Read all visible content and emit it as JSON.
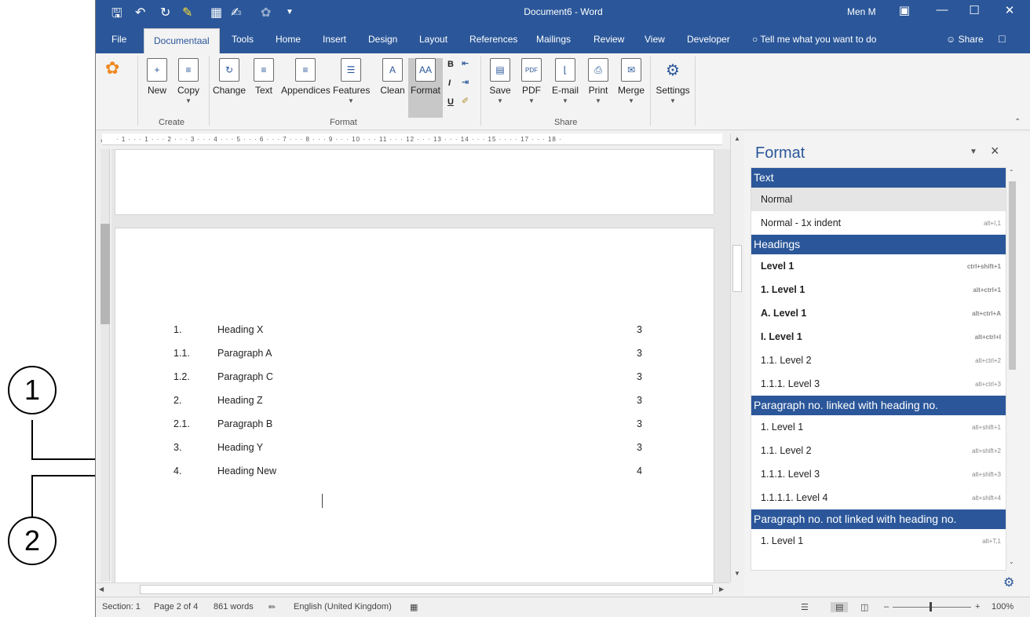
{
  "callouts": [
    "1",
    "2"
  ],
  "titlebar": {
    "title": "Document6 - Word",
    "user": "Men M",
    "icons": [
      "save-icon",
      "undo-icon",
      "redo-icon",
      "highlight-icon",
      "table-icon",
      "spelling-icon",
      "brush-icon",
      "customize-icon"
    ]
  },
  "tabs": [
    "File",
    "Documentaal",
    "Tools",
    "Home",
    "Insert",
    "Design",
    "Layout",
    "References",
    "Mailings",
    "Review",
    "View",
    "Developer"
  ],
  "active_tab": "Documentaal",
  "tell_me": "Tell me what you want to do",
  "share": "Share",
  "ribbon": {
    "create": {
      "label": "Create",
      "buttons": [
        "New",
        "Copy"
      ]
    },
    "format": {
      "label": "Format",
      "buttons": [
        "Change",
        "Text",
        "Appendices",
        "Features",
        "Clean",
        "Format"
      ],
      "small": [
        "B",
        "I",
        "U"
      ]
    },
    "share": {
      "label": "Share",
      "buttons": [
        "Save",
        "PDF",
        "E-mail",
        "Print",
        "Merge"
      ]
    },
    "settings": "Settings"
  },
  "ruler": "· 1 · · · 1 · · · 2 · · · 3 · · · 4 · · · 5 · · · 6 · · · 7 · · · 8 · · · 9 · · · 10 · · · 11 · · · 12 · · · 13 · · · 14 · · · 15 · · · · 17 · · · 18 ·",
  "toc": [
    {
      "num": "1.",
      "title": "Heading X",
      "page": "3"
    },
    {
      "num": "1.1.",
      "title": "Paragraph A",
      "page": "3"
    },
    {
      "num": "1.2.",
      "title": "Paragraph C",
      "page": "3"
    },
    {
      "num": "2.",
      "title": "Heading Z",
      "page": "3"
    },
    {
      "num": "2.1.",
      "title": "Paragraph B",
      "page": "3"
    },
    {
      "num": "3.",
      "title": "Heading Y",
      "page": "3"
    },
    {
      "num": "4.",
      "title": "Heading New",
      "page": "4"
    }
  ],
  "pane": {
    "title": "Format",
    "sections": [
      {
        "header": "Text",
        "items": [
          {
            "label": "Normal",
            "shortcut": "",
            "selected": true
          },
          {
            "label": "Normal - 1x indent",
            "shortcut": "alt+I,1"
          }
        ]
      },
      {
        "header": "Headings",
        "items": [
          {
            "label": "Level 1",
            "shortcut": "ctrl+shift+1",
            "bold": true
          },
          {
            "label": "1. Level 1",
            "shortcut": "alt+ctrl+1",
            "bold": true
          },
          {
            "label": "A. Level 1",
            "shortcut": "alt+ctrl+A",
            "bold": true
          },
          {
            "label": "I. Level 1",
            "shortcut": "alt+ctrl+I",
            "bold": true
          },
          {
            "label": "1.1. Level 2",
            "shortcut": "alt+ctrl+2"
          },
          {
            "label": "1.1.1. Level 3",
            "shortcut": "alt+ctrl+3"
          }
        ]
      },
      {
        "header": "Paragraph no. linked with heading no.",
        "items": [
          {
            "label": "1. Level 1",
            "shortcut": "alt+shift+1"
          },
          {
            "label": "1.1. Level 2",
            "shortcut": "alt+shift+2"
          },
          {
            "label": "1.1.1. Level 3",
            "shortcut": "alt+shift+3"
          },
          {
            "label": "1.1.1.1. Level 4",
            "shortcut": "alt+shift+4"
          }
        ]
      },
      {
        "header": "Paragraph no. not linked with heading no.",
        "items": [
          {
            "label": "1. Level 1",
            "shortcut": "alt+T,1"
          }
        ]
      }
    ]
  },
  "status": {
    "section": "Section: 1",
    "page": "Page 2 of 4",
    "words": "861 words",
    "language": "English (United Kingdom)",
    "zoom": "100%"
  },
  "colors": {
    "accent": "#2b579a"
  }
}
